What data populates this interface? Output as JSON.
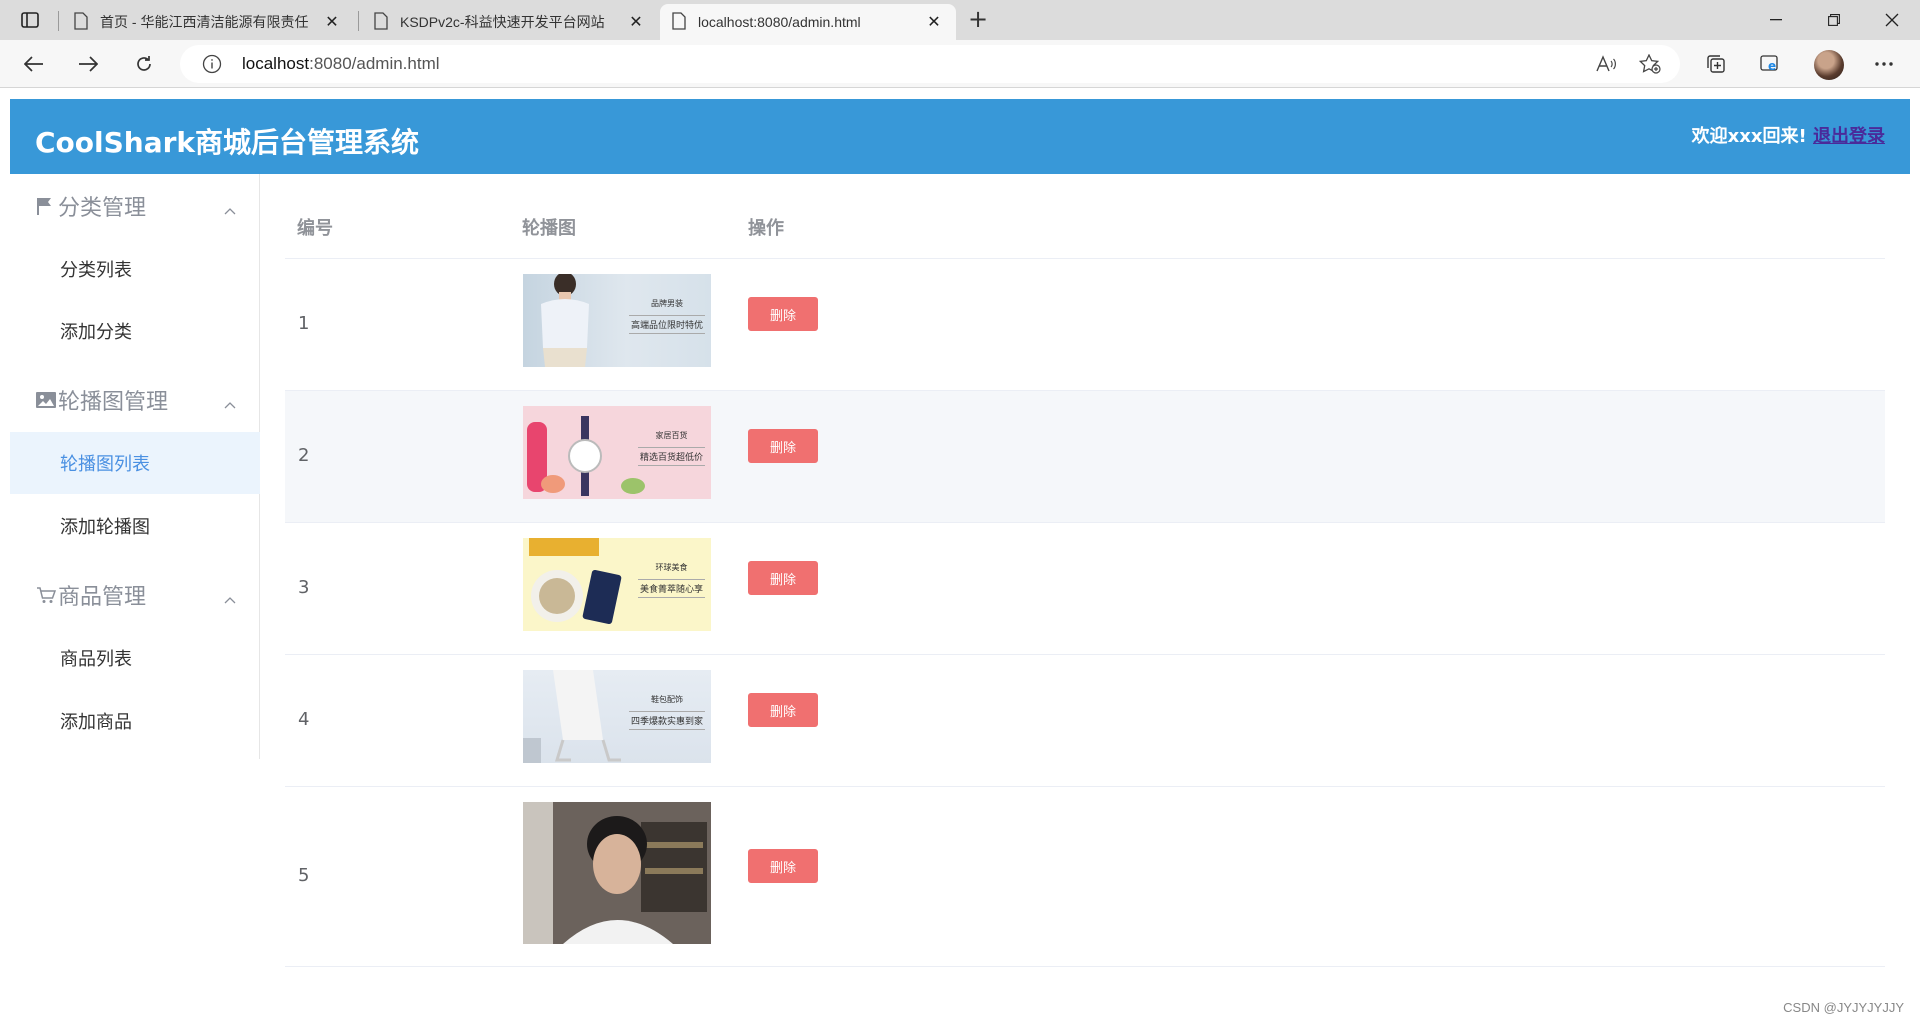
{
  "browser": {
    "tabs": [
      {
        "title": "首页 - 华能江西清洁能源有限责任"
      },
      {
        "title": "KSDPv2c-科益快速开发平台网站"
      },
      {
        "title": "localhost:8080/admin.html"
      }
    ],
    "url_host": "localhost",
    "url_rest": ":8080/admin.html"
  },
  "header": {
    "brand": "CoolShark商城后台管理系统",
    "welcome": "欢迎xxx回来!",
    "logout": "退出登录"
  },
  "sidebar": {
    "groups": [
      {
        "title": "分类管理",
        "icon": "flag-icon",
        "items": [
          {
            "label": "分类列表"
          },
          {
            "label": "添加分类"
          }
        ]
      },
      {
        "title": "轮播图管理",
        "icon": "image-icon",
        "items": [
          {
            "label": "轮播图列表"
          },
          {
            "label": "添加轮播图"
          }
        ]
      },
      {
        "title": "商品管理",
        "icon": "cart-icon",
        "items": [
          {
            "label": "商品列表"
          },
          {
            "label": "添加商品"
          }
        ]
      }
    ],
    "active_item": "轮播图列表"
  },
  "table": {
    "headers": [
      "编号",
      "轮播图",
      "操作"
    ],
    "rows": [
      {
        "id": "1",
        "caption_top": "品牌男装",
        "caption_bottom": "高端品位限时特优",
        "action": "删除"
      },
      {
        "id": "2",
        "caption_top": "家居百货",
        "caption_bottom": "精选百货超低价",
        "action": "删除"
      },
      {
        "id": "3",
        "caption_top": "环球美食",
        "caption_bottom": "美食菁萃随心享",
        "action": "删除"
      },
      {
        "id": "4",
        "caption_top": "鞋包配饰",
        "caption_bottom": "四季爆款实惠到家",
        "action": "删除"
      },
      {
        "id": "5",
        "caption_top": "",
        "caption_bottom": "",
        "action": "删除"
      }
    ]
  },
  "watermark": "CSDN @JYJYJYJJY",
  "colors": {
    "header": "#3898d8",
    "delete": "#f07070",
    "active_menu_bg": "#ebf4fd",
    "active_menu_text": "#4a90e2"
  }
}
